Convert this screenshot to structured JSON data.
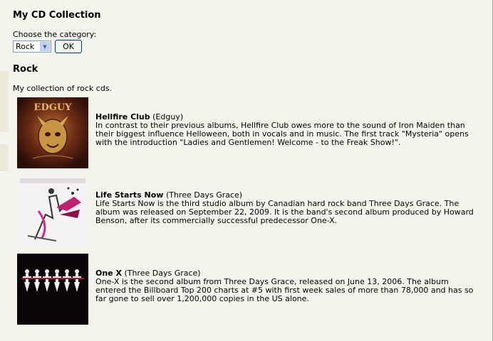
{
  "page": {
    "title": "My CD Collection",
    "choose_label": "Choose the category:",
    "category_selected": "Rock",
    "ok_label": "OK",
    "section_title": "Rock",
    "section_intro": "My collection of rock cds."
  },
  "cds": [
    {
      "title": "Hellfire Club",
      "artist": "(Edguy)",
      "cover_text": "EDGUY",
      "description": "In contrast to their previous albums, Hellfire Club owes more to the sound of Iron Maiden than their biggest influence Helloween, both in vocals and in music. The first track \"Mysteria\" opens with the introduction \"Ladies and Gentlemen! Welcome - to the Freak Show!\"."
    },
    {
      "title": "Life Starts Now",
      "artist": "(Three Days Grace)",
      "description": "Life Starts Now is the third studio album by Canadian hard rock band Three Days Grace. The album was released on September 22, 2009. It is the band's second album produced by Howard Benson, after its commercially successful predecessor One-X."
    },
    {
      "title": "One X",
      "artist": "(Three Days Grace)",
      "description": "One-X is the second album from Three Days Grace, released on June 13, 2006. The album entered the Billboard Top 200 charts at #5 with first week sales of more than 78,000 and has so far gone to sell over 1,200,000 copies in the US alone."
    }
  ]
}
